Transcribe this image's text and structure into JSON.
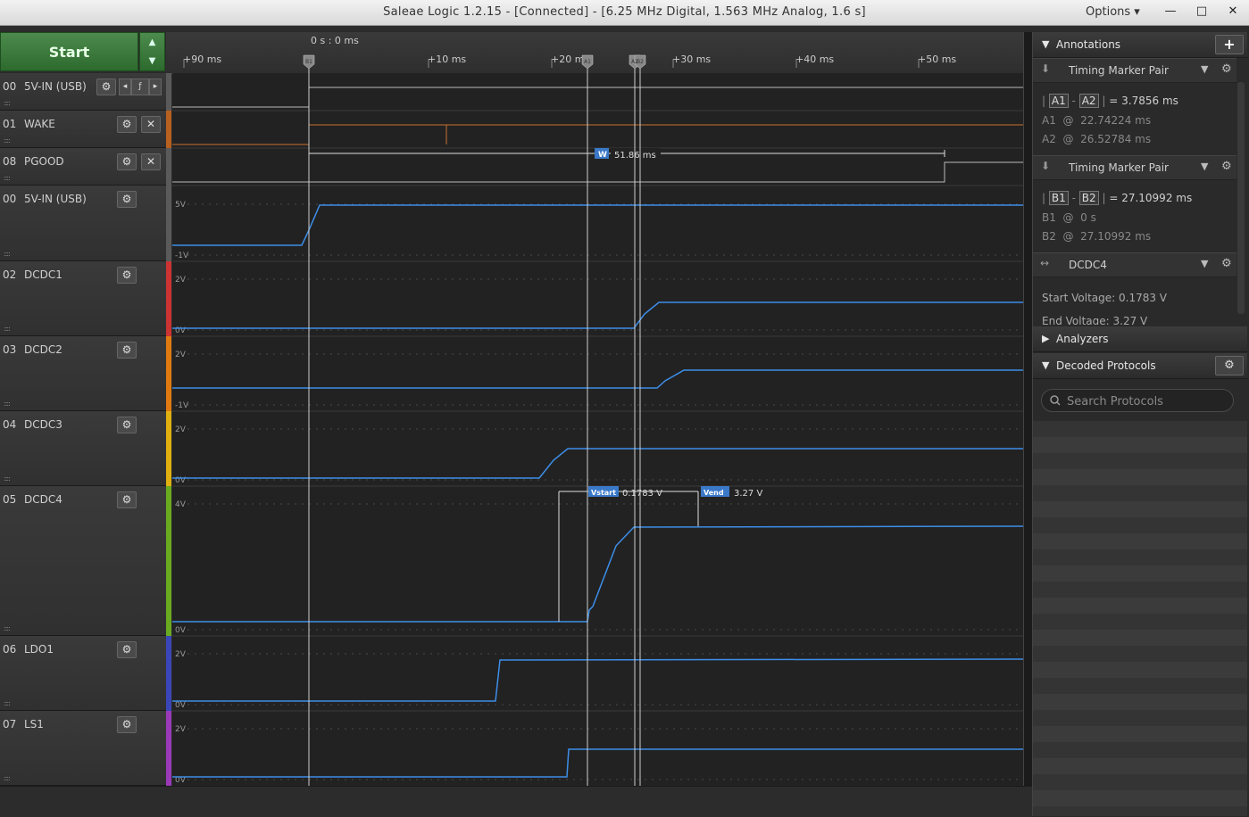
{
  "window": {
    "title": "Saleae Logic 1.2.15 - [Connected] - [6.25 MHz Digital, 1.563 MHz Analog, 1.6 s]",
    "options_label": "Options ▾",
    "minimize": "—",
    "maximize": "□",
    "close": "✕"
  },
  "toolbar": {
    "start_label": "Start",
    "up": "▲",
    "down": "▼"
  },
  "ruler": {
    "origin_label": "0 s : 0 ms",
    "ticks": [
      "+90 ms",
      "+10 ms",
      "+20 ms",
      "+30 ms",
      "+40 ms",
      "+50 ms"
    ]
  },
  "channels": [
    {
      "num": "00",
      "name": "5V-IN (USB)",
      "kind": "digital"
    },
    {
      "num": "01",
      "name": "WAKE",
      "kind": "digital"
    },
    {
      "num": "08",
      "name": "PGOOD",
      "kind": "digital"
    },
    {
      "num": "00",
      "name": "5V-IN (USB)",
      "kind": "analog",
      "top_label": "5V",
      "bottom_label": "-1V"
    },
    {
      "num": "02",
      "name": "DCDC1",
      "kind": "analog",
      "top_label": "2V",
      "bottom_label": "0V",
      "color": "#cc3333"
    },
    {
      "num": "03",
      "name": "DCDC2",
      "kind": "analog",
      "top_label": "2V",
      "bottom_label": "-1V",
      "color": "#e07a10"
    },
    {
      "num": "04",
      "name": "DCDC3",
      "kind": "analog",
      "top_label": "2V",
      "bottom_label": "0V",
      "color": "#e0b010"
    },
    {
      "num": "05",
      "name": "DCDC4",
      "kind": "analog",
      "top_label": "4V",
      "bottom_label": "0V",
      "color": "#6aaa20"
    },
    {
      "num": "06",
      "name": "LDO1",
      "kind": "analog",
      "top_label": "2V",
      "bottom_label": "0V",
      "color": "#3a46b8"
    },
    {
      "num": "07",
      "name": "LS1",
      "kind": "analog",
      "top_label": "2V",
      "bottom_label": "0V",
      "color": "#9a3ab8"
    }
  ],
  "measurements": {
    "width_tag": "W",
    "width_value": "51.86 ms",
    "vstart_tag": "Vstart",
    "vstart_value": "0.1783 V",
    "vend_tag": "Vend",
    "vend_value": "3.27 V"
  },
  "markers": {
    "a1": "A1",
    "a2": "A2",
    "b1": "B1",
    "b2": "B2"
  },
  "annotations": {
    "header": "Annotations",
    "add": "+",
    "pairs": [
      {
        "title": "Timing Marker Pair",
        "m1": "A1",
        "m2": "A2",
        "delta": "= 3.7856 ms",
        "t1_label": "A1",
        "t1": "22.74224 ms",
        "t2_label": "A2",
        "t2": "26.52784 ms"
      },
      {
        "title": "Timing Marker Pair",
        "m1": "B1",
        "m2": "B2",
        "delta": "= 27.10992 ms",
        "t1_label": "B1",
        "t1": "0 s",
        "t2_label": "B2",
        "t2": "27.10992 ms"
      }
    ],
    "measurement": {
      "title": "DCDC4",
      "start": "Start Voltage: 0.1783 V",
      "end": "End Voltage: 3.27 V"
    }
  },
  "analyzers": {
    "header": "Analyzers"
  },
  "decoded": {
    "header": "Decoded Protocols",
    "search_placeholder": "Search Protocols"
  }
}
